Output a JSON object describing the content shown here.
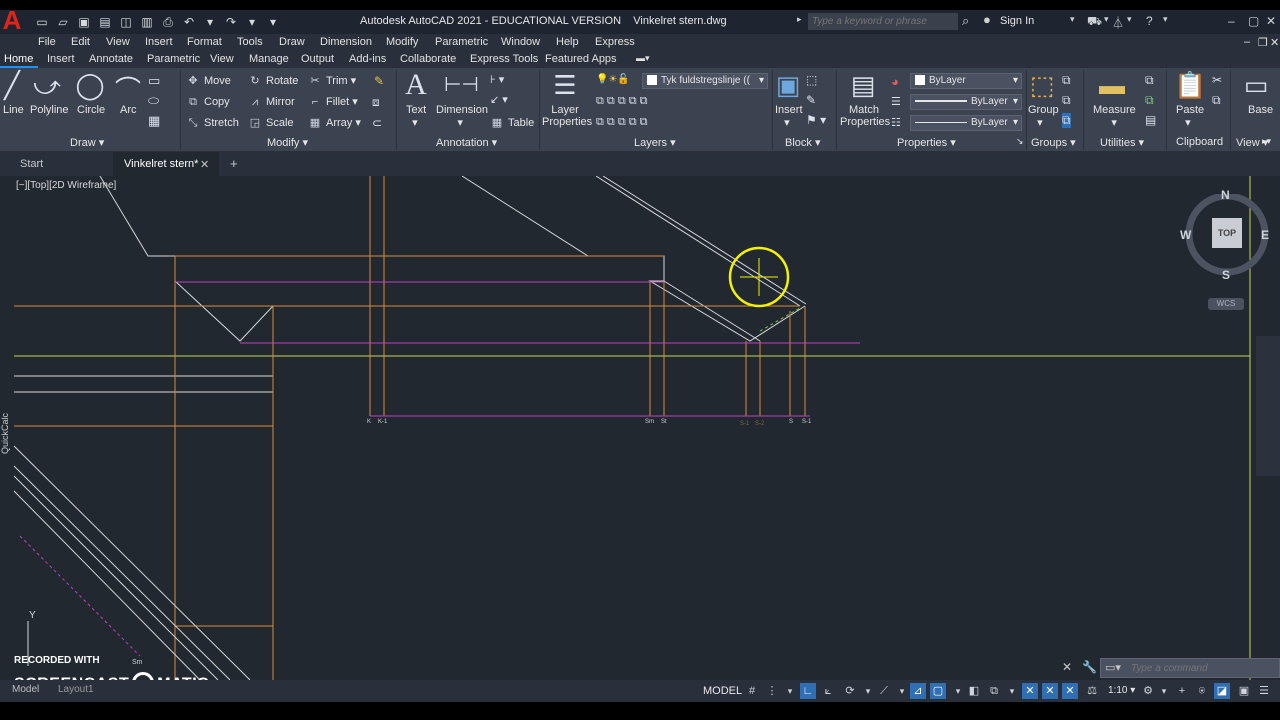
{
  "app": {
    "logo": "A",
    "title": "Autodesk AutoCAD 2021 - EDUCATIONAL VERSION",
    "filename": "Vinkelret stern.dwg",
    "search_placeholder": "Type a keyword or phrase",
    "sign_in": "Sign In"
  },
  "menu": [
    "File",
    "Edit",
    "View",
    "Insert",
    "Format",
    "Tools",
    "Draw",
    "Dimension",
    "Modify",
    "Parametric",
    "Window",
    "Help",
    "Express"
  ],
  "ribbon_tabs": [
    "Home",
    "Insert",
    "Annotate",
    "Parametric",
    "View",
    "Manage",
    "Output",
    "Add-ins",
    "Collaborate",
    "Express Tools",
    "Featured Apps"
  ],
  "ribbon": {
    "draw": {
      "label": "Draw",
      "line": "Line",
      "polyline": "Polyline",
      "circle": "Circle",
      "arc": "Arc"
    },
    "modify": {
      "label": "Modify",
      "move": "Move",
      "rotate": "Rotate",
      "trim": "Trim",
      "copy": "Copy",
      "mirror": "Mirror",
      "fillet": "Fillet",
      "stretch": "Stretch",
      "scale": "Scale",
      "array": "Array"
    },
    "annotation": {
      "label": "Annotation",
      "text": "Text",
      "dimension": "Dimension",
      "table": "Table"
    },
    "layers": {
      "label": "Layers",
      "layer_properties_1": "Layer",
      "layer_properties_2": "Properties",
      "current_layer": "Tyk fuldstregslinje (("
    },
    "block": {
      "label": "Block",
      "insert": "Insert"
    },
    "properties": {
      "label": "Properties",
      "match_1": "Match",
      "match_2": "Properties",
      "color": "ByLayer",
      "lineweight": "ByLayer",
      "linetype": "ByLayer"
    },
    "groups": {
      "label": "Groups",
      "group": "Group"
    },
    "utilities": {
      "label": "Utilities",
      "measure": "Measure"
    },
    "clipboard": {
      "label": "Clipboard",
      "paste": "Paste"
    },
    "view": {
      "label": "View",
      "base": "Base"
    }
  },
  "doc_tabs": {
    "start": "Start",
    "active": "Vinkelret stern*",
    "add": "+"
  },
  "viewport": {
    "label": "[−][Top][2D Wireframe]",
    "quickcalc": "QuickCalc",
    "compass": {
      "n": "N",
      "s": "S",
      "e": "E",
      "w": "W",
      "top": "TOP"
    },
    "wcs": "WCS",
    "ucs_y": "Y"
  },
  "drawing_labels": {
    "k": "K",
    "k1": "K-1",
    "sm": "Sm",
    "st": "St",
    "s1": "S-1",
    "s2": "S-2",
    "s": "S",
    "s_1": "S-1",
    "sm2": "Sm"
  },
  "watermark": {
    "line1": "RECORDED WITH",
    "line2a": "SCREENCAST",
    "line2b": "MATIC"
  },
  "command": {
    "placeholder": "Type a command"
  },
  "status": {
    "model": "MODEL",
    "scale": "1:10"
  },
  "layout_tabs": {
    "model": "Model",
    "layout": "Layout1"
  },
  "colors": {
    "canvas": "#212830",
    "orange": "#d98a3c",
    "magenta": "#c040c0",
    "yellow_green": "#c8d84a",
    "white_line": "#d6d6d6",
    "cursor": "#f2f200"
  }
}
